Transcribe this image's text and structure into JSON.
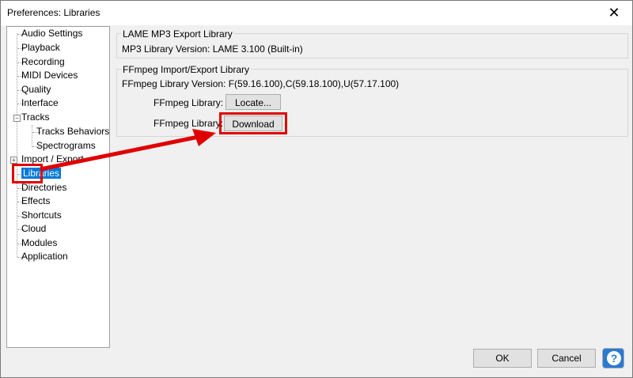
{
  "window": {
    "title": "Preferences: Libraries",
    "close_glyph": "✕"
  },
  "tree": {
    "items": [
      {
        "label": "Audio Settings"
      },
      {
        "label": "Playback"
      },
      {
        "label": "Recording"
      },
      {
        "label": "MIDI Devices"
      },
      {
        "label": "Quality"
      },
      {
        "label": "Interface"
      },
      {
        "label": "Tracks"
      },
      {
        "label": "Tracks Behaviors"
      },
      {
        "label": "Spectrograms"
      },
      {
        "label": "Import / Export"
      },
      {
        "label": "Libraries"
      },
      {
        "label": "Directories"
      },
      {
        "label": "Effects"
      },
      {
        "label": "Shortcuts"
      },
      {
        "label": "Cloud"
      },
      {
        "label": "Modules"
      },
      {
        "label": "Application"
      }
    ],
    "expanded_glyph": "−",
    "collapsed_glyph": "+"
  },
  "lame": {
    "group_title": "LAME MP3 Export Library",
    "version_text": "MP3 Library Version: LAME 3.100 (Built-in)"
  },
  "ffmpeg": {
    "group_title": "FFmpeg Import/Export Library",
    "version_text": "FFmpeg Library Version: F(59.16.100),C(59.18.100),U(57.17.100)",
    "locate_label": "FFmpeg Library:",
    "locate_button": "Locate...",
    "download_label": "FFmpeg Library:",
    "download_button": "Download"
  },
  "buttons": {
    "ok": "OK",
    "cancel": "Cancel",
    "help": "?"
  },
  "colors": {
    "highlight": "#e00000",
    "selection": "#0078d7",
    "help": "#2a79d3"
  }
}
